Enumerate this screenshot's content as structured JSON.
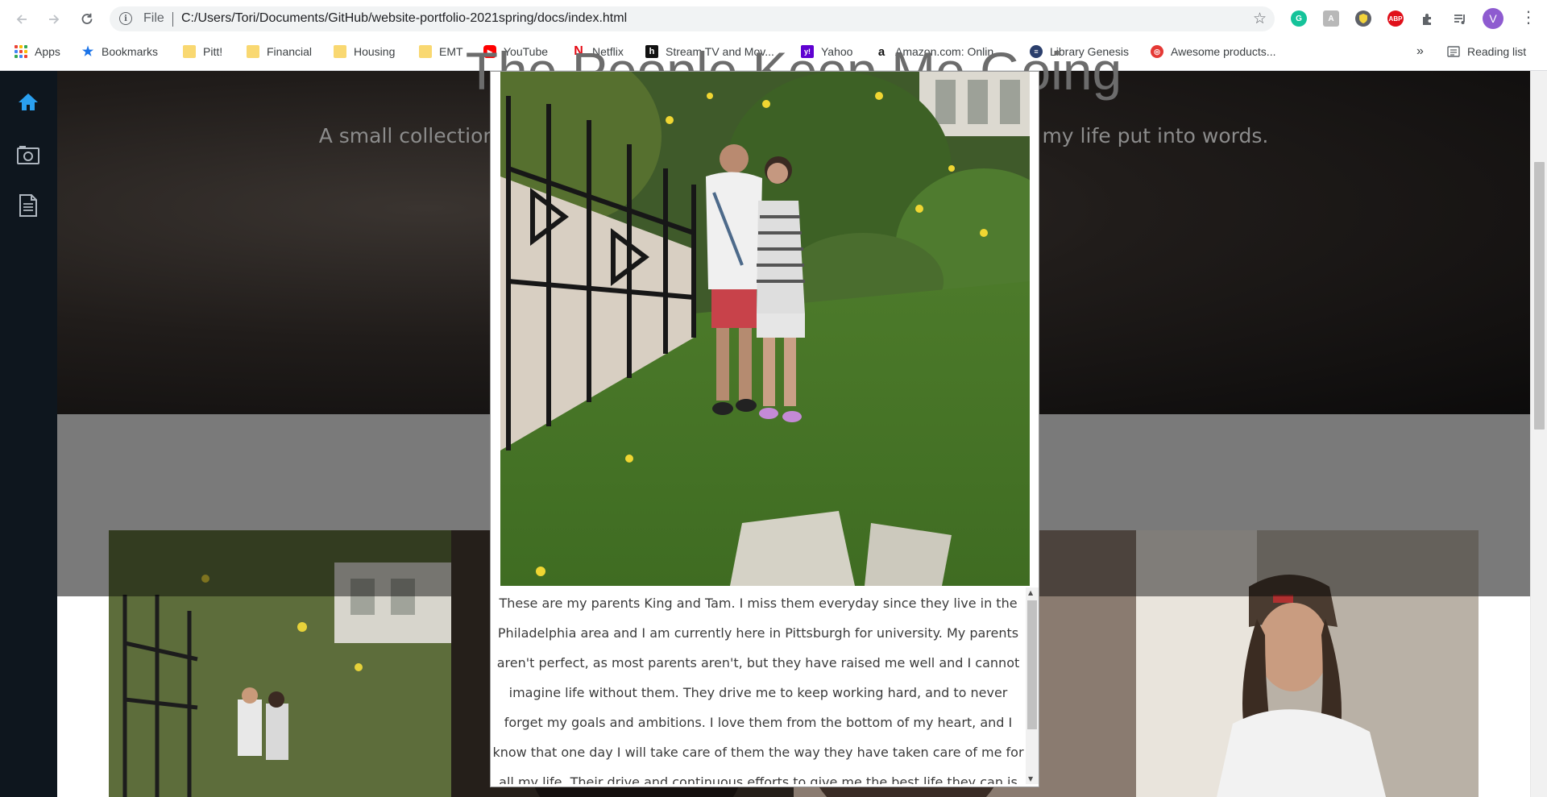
{
  "browser": {
    "url_scheme": "File",
    "url": "C:/Users/Tori/Documents/GitHub/website-portfolio-2021spring/docs/index.html",
    "profile_initial": "V",
    "bookmarks": [
      {
        "label": "Apps",
        "icon": "apps-grid-icon"
      },
      {
        "label": "Bookmarks",
        "icon": "star-icon"
      },
      {
        "label": "Pitt!",
        "icon": "folder-icon"
      },
      {
        "label": "Financial",
        "icon": "folder-icon"
      },
      {
        "label": "Housing",
        "icon": "folder-icon"
      },
      {
        "label": "EMT",
        "icon": "folder-icon"
      },
      {
        "label": "YouTube",
        "icon": "youtube-icon"
      },
      {
        "label": "Netflix",
        "icon": "netflix-icon"
      },
      {
        "label": "Stream TV and Mov...",
        "icon": "hulu-icon"
      },
      {
        "label": "Yahoo",
        "icon": "yahoo-icon"
      },
      {
        "label": "Amazon.com: Onlin...",
        "icon": "amazon-icon"
      },
      {
        "label": "Library Genesis",
        "icon": "library-icon"
      },
      {
        "label": "Awesome products...",
        "icon": "product-icon"
      }
    ],
    "overflow_label": "»",
    "reading_list": "Reading list",
    "extensions": [
      {
        "name": "grammarly-icon",
        "color": "#15c39a"
      },
      {
        "name": "extension-gray-icon",
        "color": "#b0b0b0"
      },
      {
        "name": "shield-extension-icon",
        "color": "#6b6b6b"
      },
      {
        "name": "adblock-icon",
        "color": "#e0101a"
      }
    ]
  },
  "hero": {
    "title": "The People Keep Me Going",
    "subtitle": "A small collection of the thoughts and gratitude I hold for the people in my life put into words."
  },
  "sidebar": {
    "items": [
      {
        "name": "home-icon",
        "color": "#2aa0f0"
      },
      {
        "name": "photo-icon",
        "color": "#aeb6bf"
      },
      {
        "name": "document-icon",
        "color": "#aeb6bf"
      }
    ]
  },
  "modal": {
    "caption": "These are my parents King and Tam. I miss them everyday since they live in the Philadelphia area and I am currently here in Pittsburgh for university. My parents aren't perfect, as most parents aren't, but they have raised me well and I cannot imagine life without them. They drive me to keep working hard, and to never forget my goals and ambitions. I love them from the bottom of my heart, and I know that one day I will take care of them the way they have taken care of me for all my life. Their drive and continuous efforts to give me the best life they can is"
  },
  "colors": {
    "accent": "#2aa0f0",
    "sidebar_bg": "#0e161e"
  }
}
